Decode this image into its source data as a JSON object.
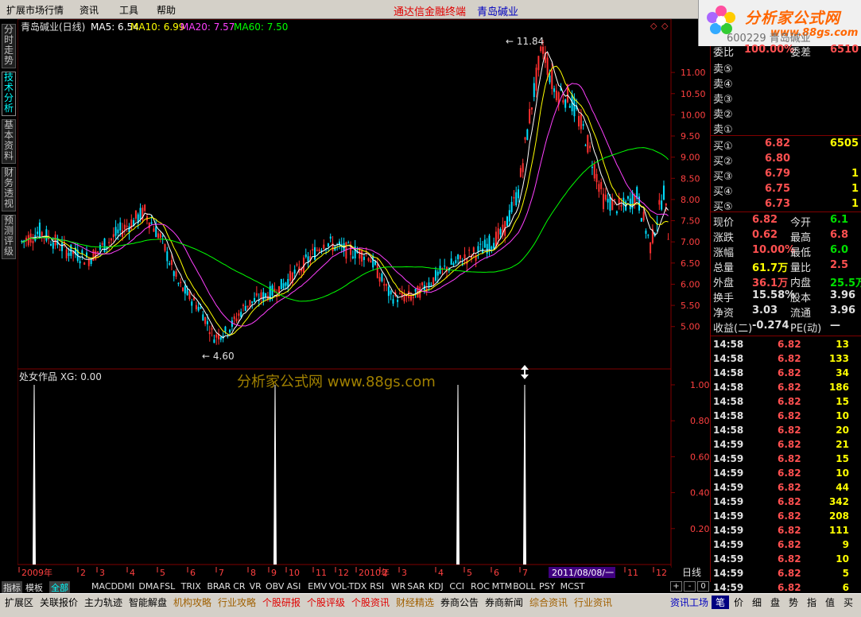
{
  "menu": {
    "items": [
      "扩展市场行情",
      "资讯",
      "工具",
      "帮助"
    ],
    "brand_title": "通达信金融终端",
    "stock_name": "青岛碱业"
  },
  "logo": {
    "text": "分析家公式网",
    "url_text": "www.88gs.com"
  },
  "left_tabs": [
    {
      "label": "分时走势",
      "active": false
    },
    {
      "label": "技术分析",
      "active": true
    },
    {
      "label": "基本资料",
      "active": false
    },
    {
      "label": "财务透视",
      "active": false
    },
    {
      "label": "预测评级",
      "active": false
    }
  ],
  "main_chart": {
    "legend": {
      "name": "青岛碱业(日线)",
      "ma5": "MA5: 6.54",
      "ma10": "MA10: 6.99",
      "ma20": "MA20: 7.57",
      "ma60": "MA60: 7.50"
    },
    "high_label": "11.84",
    "low_label": "4.60",
    "y_ticks": [
      "11.00",
      "10.50",
      "10.00",
      "9.50",
      "9.00",
      "8.50",
      "8.00",
      "7.50",
      "7.00",
      "6.50",
      "6.00",
      "5.50",
      "5.00"
    ],
    "colors": {
      "up": "#ff3030",
      "down": "#00e0ff",
      "ma5": "#ffffff",
      "ma10": "#ffff00",
      "ma20": "#ff40ff",
      "ma60": "#00ff00",
      "grid": "#800000"
    }
  },
  "indicator": {
    "legend": "处女作品 XG: 0.00",
    "watermark": "分析家公式网 www.88gs.com",
    "y_ticks": [
      "1.00",
      "0.80",
      "0.60",
      "0.40",
      "0.20"
    ],
    "cursor_icon": "resize-vertical-icon"
  },
  "time_axis": {
    "labels": [
      "2009年",
      "2",
      "3",
      "4",
      "5",
      "6",
      "7",
      "8",
      "9",
      "10",
      "11",
      "12",
      "2010年",
      "2",
      "3",
      "4",
      "5",
      "6",
      "7",
      "8",
      "9",
      "10",
      "11",
      "12"
    ],
    "cursor_date": "2011/08/08/一",
    "period": "日线"
  },
  "indicator_tabs": {
    "lead": [
      "指标",
      "模板",
      "全部"
    ],
    "items": [
      "MACD",
      "DMI",
      "DMA",
      "FSL",
      "TRIX",
      "BRAR",
      "CR",
      "VR",
      "OBV",
      "ASI",
      "EMV",
      "VOL-TDX",
      "RSI",
      "WR",
      "SAR",
      "KDJ",
      "CCI",
      "ROC",
      "MTM",
      "BOLL",
      "PSY",
      "MCST"
    ],
    "controls": [
      "+",
      "-",
      "0"
    ]
  },
  "quote": {
    "code_partial": "600229 青岛碱业",
    "weibi_label": "委比",
    "weibi_value": "100.00%",
    "weicha_label": "委差",
    "weicha_value": "6510",
    "sell": [
      {
        "label": "卖⑤"
      },
      {
        "label": "卖④"
      },
      {
        "label": "卖③"
      },
      {
        "label": "卖②"
      },
      {
        "label": "卖①"
      }
    ],
    "buy": [
      {
        "label": "买①",
        "price": "6.82",
        "vol": "6505"
      },
      {
        "label": "买②",
        "price": "6.80",
        "vol": ""
      },
      {
        "label": "买③",
        "price": "6.79",
        "vol": "1"
      },
      {
        "label": "买④",
        "price": "6.75",
        "vol": "1"
      },
      {
        "label": "买⑤",
        "price": "6.73",
        "vol": "1"
      }
    ],
    "stats": [
      {
        "l1": "现价",
        "v1": "6.82",
        "c1": "red",
        "l2": "今开",
        "v2": "6.1",
        "c2": "grn"
      },
      {
        "l1": "涨跌",
        "v1": "0.62",
        "c1": "red",
        "l2": "最高",
        "v2": "6.8",
        "c2": "red"
      },
      {
        "l1": "涨幅",
        "v1": "10.00%",
        "c1": "red",
        "l2": "最低",
        "v2": "6.0",
        "c2": "grn"
      },
      {
        "l1": "总量",
        "v1": "61.7万",
        "c1": "yel",
        "l2": "量比",
        "v2": "2.5",
        "c2": "red"
      },
      {
        "l1": "外盘",
        "v1": "36.1万",
        "c1": "red",
        "l2": "内盘",
        "v2": "25.5万",
        "c2": "grn"
      },
      {
        "l1": "换手",
        "v1": "15.58%",
        "c1": "wht",
        "l2": "股本",
        "v2": "3.96",
        "c2": "wht"
      },
      {
        "l1": "净资",
        "v1": "3.03",
        "c1": "wht",
        "l2": "流通",
        "v2": "3.96",
        "c2": "wht"
      },
      {
        "l1": "收益(二)",
        "v1": "-0.274",
        "c1": "wht",
        "l2": "PE(动)",
        "v2": "—",
        "c2": "wht"
      }
    ],
    "ticks": [
      {
        "time": "14:58",
        "price": "6.82",
        "vol": "13"
      },
      {
        "time": "14:58",
        "price": "6.82",
        "vol": "133"
      },
      {
        "time": "14:58",
        "price": "6.82",
        "vol": "34"
      },
      {
        "time": "14:58",
        "price": "6.82",
        "vol": "186"
      },
      {
        "time": "14:58",
        "price": "6.82",
        "vol": "15"
      },
      {
        "time": "14:58",
        "price": "6.82",
        "vol": "10"
      },
      {
        "time": "14:58",
        "price": "6.82",
        "vol": "20"
      },
      {
        "time": "14:59",
        "price": "6.82",
        "vol": "21"
      },
      {
        "time": "14:59",
        "price": "6.82",
        "vol": "15"
      },
      {
        "time": "14:59",
        "price": "6.82",
        "vol": "10"
      },
      {
        "time": "14:59",
        "price": "6.82",
        "vol": "44"
      },
      {
        "time": "14:59",
        "price": "6.82",
        "vol": "342"
      },
      {
        "time": "14:59",
        "price": "6.82",
        "vol": "208"
      },
      {
        "time": "14:59",
        "price": "6.82",
        "vol": "111"
      },
      {
        "time": "14:59",
        "price": "6.82",
        "vol": "9"
      },
      {
        "time": "14:59",
        "price": "6.82",
        "vol": "10"
      },
      {
        "time": "14:59",
        "price": "6.82",
        "vol": "5"
      },
      {
        "time": "14:59",
        "price": "6.82",
        "vol": "6"
      }
    ]
  },
  "statusbar": {
    "items": [
      "扩展区",
      "关联报价",
      "主力轨迹",
      "智能解盘",
      "机构攻略",
      "行业攻略",
      "个股研报",
      "个股评级",
      "个股资讯",
      "财经精选",
      "券商公告",
      "券商新闻",
      "综合资讯",
      "行业资讯"
    ],
    "right_label": "资讯工场",
    "right_buttons": [
      "笔",
      "价",
      "细",
      "盘",
      "势",
      "指",
      "值",
      "买"
    ]
  }
}
